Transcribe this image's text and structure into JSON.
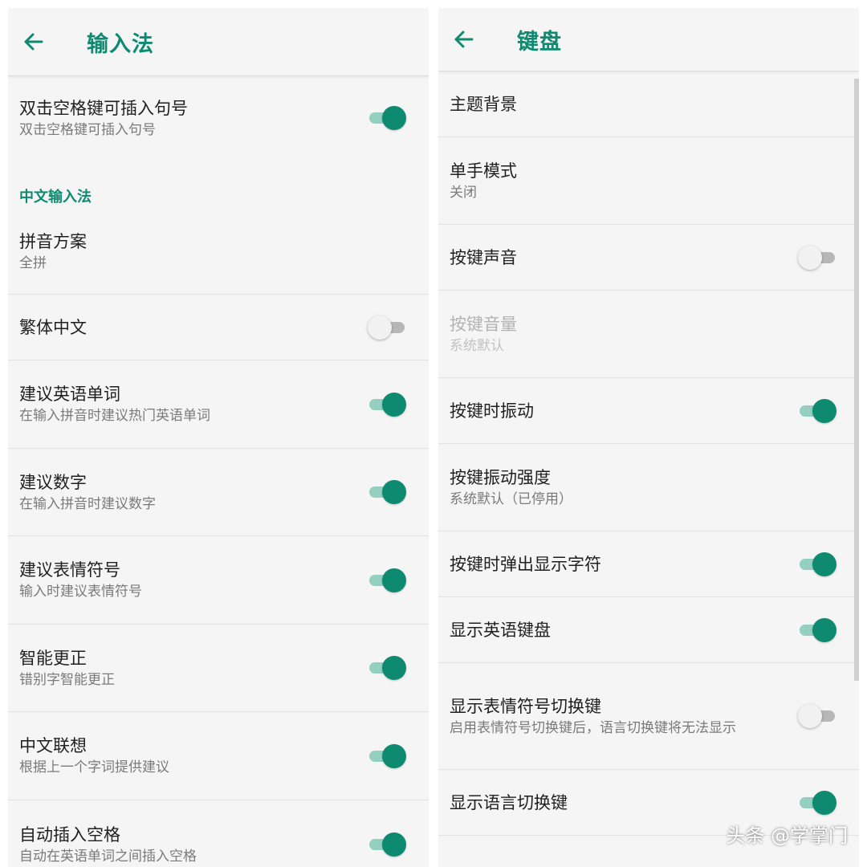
{
  "left": {
    "title": "输入法",
    "rows": [
      {
        "title": "双击空格键可插入句号",
        "sub": "双击空格键可插入句号",
        "toggle": "on"
      },
      {
        "title": "拼音方案",
        "sub": "全拼"
      },
      {
        "title": "繁体中文",
        "toggle": "off"
      },
      {
        "title": "建议英语单词",
        "sub": "在输入拼音时建议热门英语单词",
        "toggle": "on"
      },
      {
        "title": "建议数字",
        "sub": "在输入拼音时建议数字",
        "toggle": "on"
      },
      {
        "title": "建议表情符号",
        "sub": "输入时建议表情符号",
        "toggle": "on"
      },
      {
        "title": "智能更正",
        "sub": "错别字智能更正",
        "toggle": "on"
      },
      {
        "title": "中文联想",
        "sub": "根据上一个字词提供建议",
        "toggle": "on"
      },
      {
        "title": "自动插入空格",
        "sub": "自动在英语单词之间插入空格",
        "toggle": "on"
      }
    ],
    "section_header": "中文输入法"
  },
  "right": {
    "title": "键盘",
    "rows": [
      {
        "title": "主题背景"
      },
      {
        "title": "单手模式",
        "sub": "关闭"
      },
      {
        "title": "按键声音",
        "toggle": "off"
      },
      {
        "title": "按键音量",
        "sub": "系统默认",
        "disabled": true
      },
      {
        "title": "按键时振动",
        "toggle": "on"
      },
      {
        "title": "按键振动强度",
        "sub": "系统默认（已停用）"
      },
      {
        "title": "按键时弹出显示字符",
        "toggle": "on"
      },
      {
        "title": "显示英语键盘",
        "toggle": "on"
      },
      {
        "title": "显示表情符号切换键",
        "sub": "启用表情符号切换键后，语言切换键将无法显示",
        "toggle": "off"
      },
      {
        "title": "显示语言切换键",
        "toggle": "on"
      }
    ]
  },
  "watermark": "头条 @学掌门",
  "colors": {
    "accent": "#0e8a71",
    "track_on": "#94cfc0",
    "background": "#f5f5f5"
  },
  "icons": {
    "back": "arrow-left-icon"
  }
}
